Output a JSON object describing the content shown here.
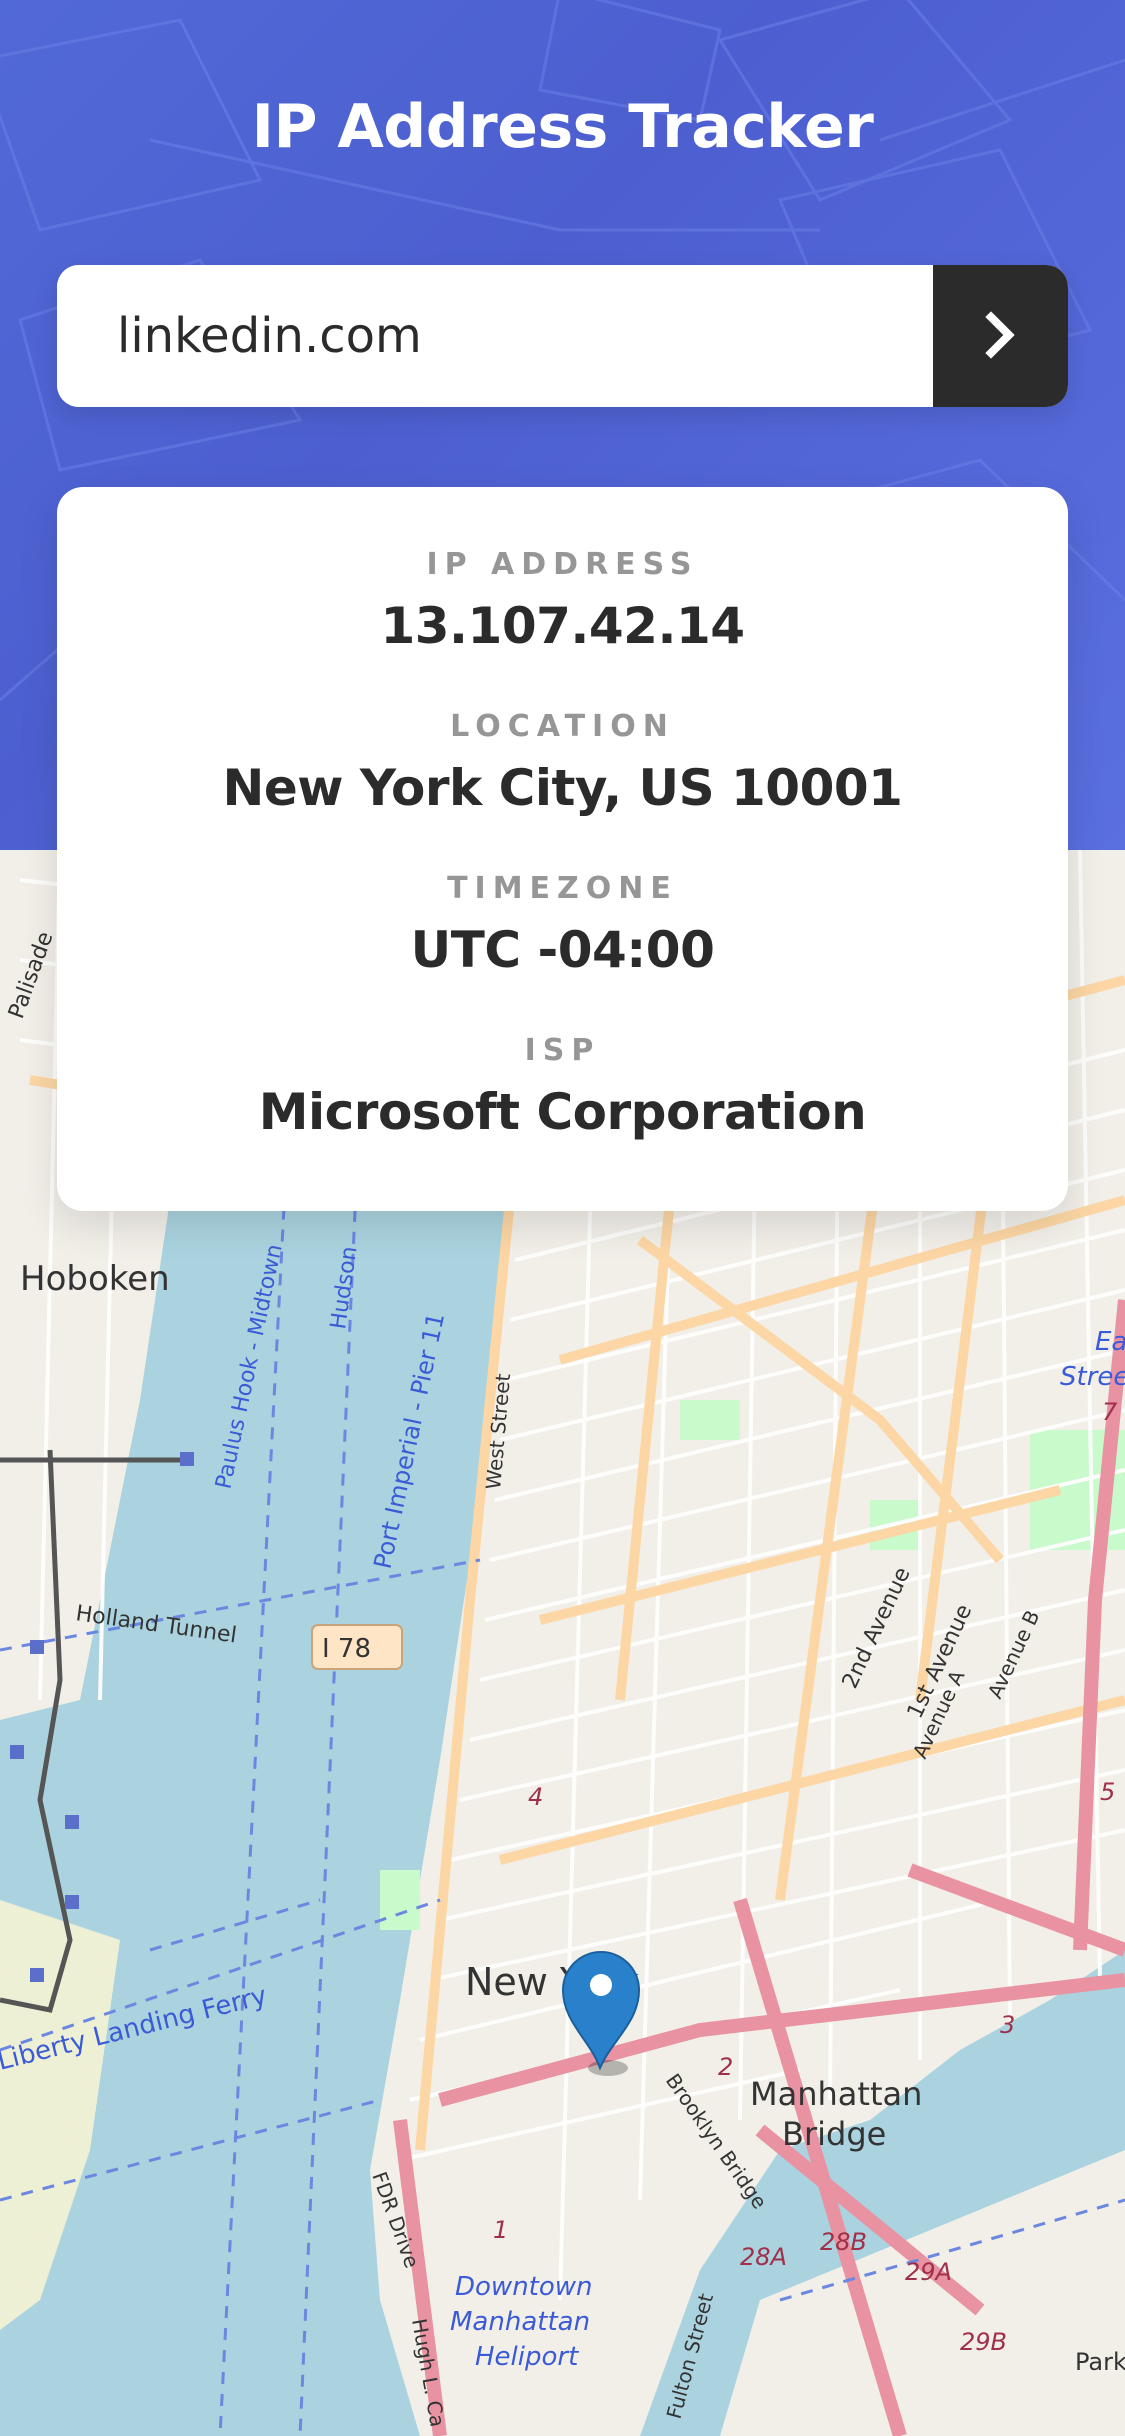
{
  "header": {
    "title": "IP Address Tracker"
  },
  "search": {
    "value": "linkedin.com",
    "submit_icon": "chevron-right-icon"
  },
  "info": {
    "ip_label": "IP ADDRESS",
    "ip_value": "13.107.42.14",
    "location_label": "LOCATION",
    "location_value": "New York City, US 10001",
    "timezone_label": "TIMEZONE",
    "timezone_value": "UTC -04:00",
    "isp_label": "ISP",
    "isp_value": "Microsoft Corporation"
  },
  "map": {
    "marker_icon": "map-pin-icon",
    "labels": {
      "hoboken": "Hoboken",
      "new_york": "New York",
      "manhattan": "Manhattan",
      "bridge": "Bridge",
      "holland_tunnel": "Holland Tunnel",
      "i78": "I 78",
      "west_street": "West Street",
      "paulus_hook": "Paulus Hook - Midtown",
      "port_imperial": "Port Imperial - Pier 11",
      "hudson": "Hudson",
      "liberty_ferry": "Liberty Landing Ferry",
      "second_ave": "2nd Avenue",
      "first_ave": "1st Avenue",
      "ave_a": "Avenue A",
      "ave_b": "Avenue B",
      "brooklyn_bridge": "Brooklyn Bridge",
      "fdr_drive": "FDR Drive",
      "downtown": "Downtown",
      "manhattan2": "Manhattan",
      "heliport": "Heliport",
      "hugh_l": "Hugh L. Ca",
      "fulton_street": "Fulton Street",
      "palisade": "Palisade",
      "east_st": "Ea",
      "stree": "Stree",
      "park": "Park",
      "r28a": "28A",
      "r28b": "28B",
      "r29a": "29A",
      "r29b": "29B",
      "r3": "3",
      "r1": "1",
      "r2": "2",
      "r4": "4",
      "r5": "5",
      "r7": "7"
    },
    "colors": {
      "water": "#aad3df",
      "land": "#f2efe9",
      "major_road": "#fcd6a4",
      "highway": "#e892a2",
      "street": "#fefefe",
      "park": "#c8facc",
      "marker": "#2a81cb"
    }
  },
  "colors": {
    "header_bg": "#5169d6",
    "button_bg": "#2b2b2b",
    "label_gray": "#969696",
    "value_dark": "#2b2b2b"
  }
}
